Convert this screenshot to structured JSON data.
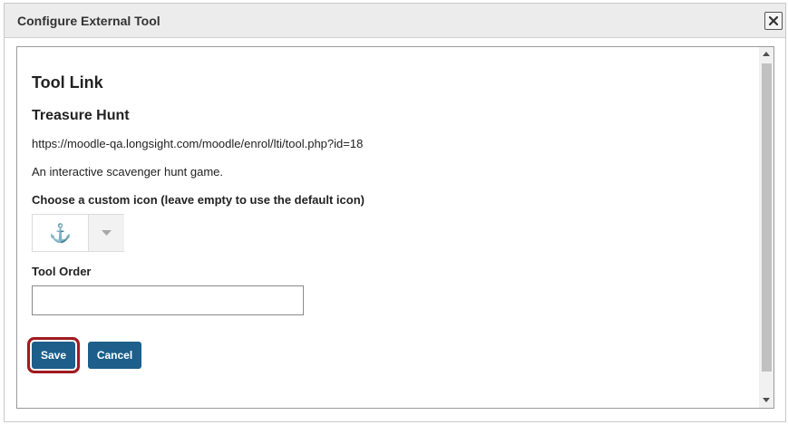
{
  "dialog": {
    "title": "Configure External Tool",
    "close_icon": "close-icon"
  },
  "form": {
    "heading": "Tool Link",
    "tool_name": "Treasure Hunt",
    "tool_url": "https://moodle-qa.longsight.com/moodle/enrol/lti/tool.php?id=18",
    "description": "An interactive scavenger hunt game.",
    "icon_label": "Choose a custom icon (leave empty to use the default icon)",
    "icon_picker": {
      "selected_glyph": "⚓",
      "selected_icon": "anchor-icon",
      "dropdown_icon": "caret-down-icon"
    },
    "order_label": "Tool Order",
    "order_value": "",
    "save_label": "Save",
    "cancel_label": "Cancel"
  },
  "scrollbar": {
    "up_icon": "scroll-up-arrow-icon",
    "down_icon": "scroll-down-arrow-icon"
  },
  "colors": {
    "button": "#1d5f8a",
    "highlight_ring": "#a01a1f",
    "titlebar": "#ececec"
  }
}
